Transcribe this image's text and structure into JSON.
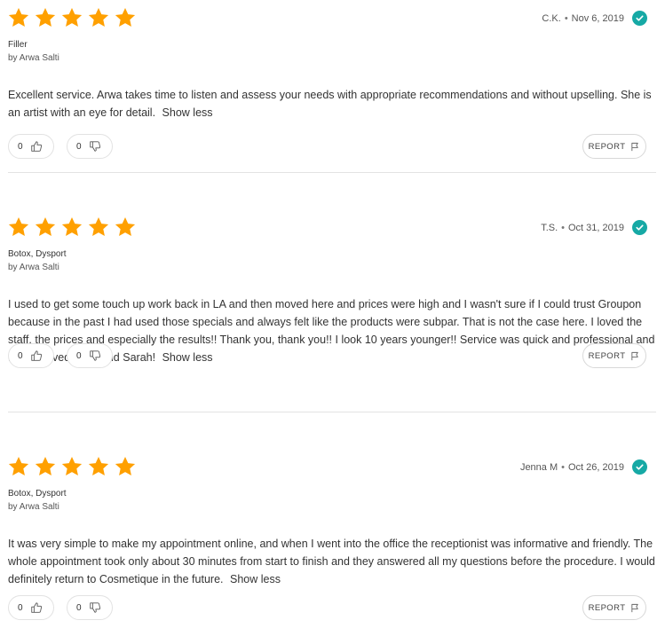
{
  "colors": {
    "star": "#ffa000",
    "verified": "#16a9a5",
    "divider": "#e3e3e3"
  },
  "icons": {
    "rating": "star-icon",
    "verified": "check-circle-icon",
    "like": "thumbs-up-icon",
    "dislike": "thumbs-down-icon",
    "report": "flag-icon"
  },
  "reviews": [
    {
      "rating": 5,
      "author": "C.K.",
      "separator": "•",
      "date": "Nov 6, 2019",
      "procedure": "Filler",
      "provider": "by Arwa Salti",
      "text": "Excellent service. Arwa takes time to listen and assess your needs with appropriate recommendations and without upselling. She is an artist with an eye for detail.",
      "show_less": "Show less",
      "likes": "0",
      "dislikes": "0",
      "report_label": "REPORT"
    },
    {
      "rating": 5,
      "author": "T.S.",
      "separator": "•",
      "date": "Oct 31, 2019",
      "procedure": "Botox, Dysport",
      "provider": "by Arwa Salti",
      "text": "I used to get some touch up work back in LA and then moved here and prices were high and I wasn't sure if I could trust Groupon because in the past I had used those specials and always felt like the products were subpar. That is not the case here. I loved the staff, the prices and especially the results!! Thank you, thank you!! I look 10 years younger!! Service was quick and professional and I really loved Arwa and Sarah!",
      "show_less": "Show less",
      "likes": "0",
      "dislikes": "0",
      "report_label": "REPORT"
    },
    {
      "rating": 5,
      "author": "Jenna M",
      "separator": "•",
      "date": "Oct 26, 2019",
      "procedure": "Botox, Dysport",
      "provider": "by Arwa Salti",
      "text": "It was very simple to make my appointment online, and when I went into the office the receptionist was informative and friendly. The whole appointment took only about 30 minutes from start to finish and they answered all my questions before the procedure. I would definitely return to Cosmetique in the future.",
      "show_less": "Show less",
      "likes": "0",
      "dislikes": "0",
      "report_label": "REPORT"
    }
  ]
}
